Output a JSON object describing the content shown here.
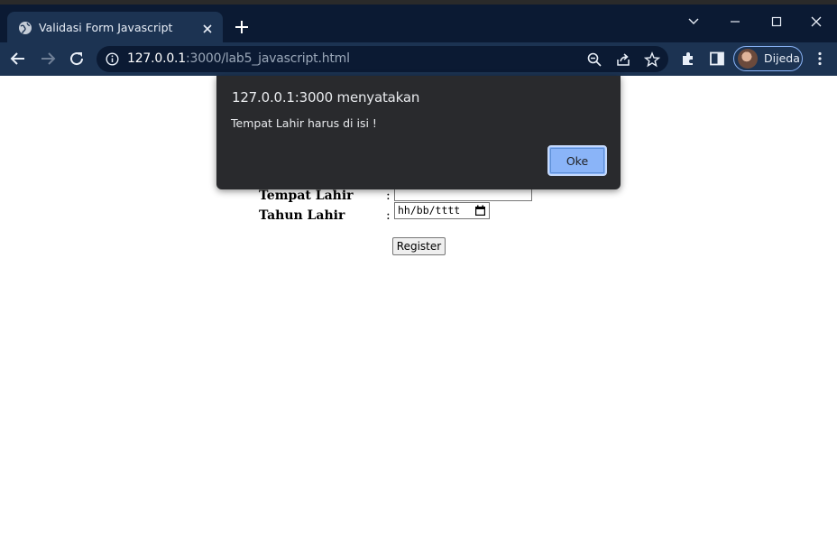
{
  "browser": {
    "tab_title": "Validasi Form Javascript",
    "url_host": "127.0.0.1",
    "url_rest": ":3000/lab5_javascript.html",
    "profile_name": "Dijeda",
    "colors": {
      "tabstrip": "#0b1a33",
      "toolbar": "#1c3352",
      "omnibox": "#0b1a33"
    }
  },
  "form": {
    "fields": [
      {
        "label": "Tempat Lahir",
        "colon": ":",
        "type": "text",
        "value": ""
      },
      {
        "label": "Tahun Lahir",
        "colon": ":",
        "type": "date",
        "value": "hh/bb/tttt"
      }
    ],
    "submit_label": "Register"
  },
  "dialog": {
    "title": "127.0.0.1:3000 menyatakan",
    "message": "Tempat Lahir harus di isi !",
    "ok_label": "Oke",
    "colors": {
      "background": "#292a2d",
      "button": "#8ab4f8"
    }
  }
}
